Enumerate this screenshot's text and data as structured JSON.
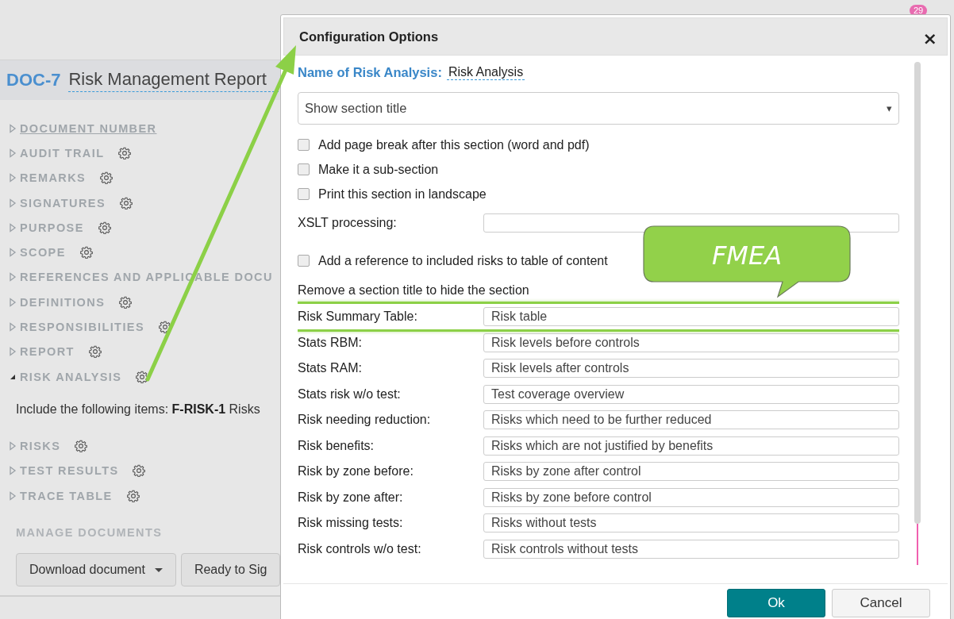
{
  "badge": "29",
  "document": {
    "id": "DOC-7",
    "title": "Risk Management Report"
  },
  "sections": [
    {
      "label": "DOCUMENT NUMBER",
      "expanded": false,
      "underlined": true,
      "settings": false
    },
    {
      "label": "AUDIT TRAIL",
      "expanded": false,
      "underlined": false,
      "settings": true
    },
    {
      "label": "REMARKS",
      "expanded": false,
      "underlined": false,
      "settings": true
    },
    {
      "label": "SIGNATURES",
      "expanded": false,
      "underlined": false,
      "settings": true
    },
    {
      "label": "PURPOSE",
      "expanded": false,
      "underlined": false,
      "settings": true
    },
    {
      "label": "SCOPE",
      "expanded": false,
      "underlined": false,
      "settings": true
    },
    {
      "label": "REFERENCES AND APPLICABLE DOCU",
      "expanded": false,
      "underlined": false,
      "settings": false
    },
    {
      "label": "DEFINITIONS",
      "expanded": false,
      "underlined": false,
      "settings": true
    },
    {
      "label": "RESPONSIBILITIES",
      "expanded": false,
      "underlined": false,
      "settings": true
    },
    {
      "label": "REPORT",
      "expanded": false,
      "underlined": false,
      "settings": true
    },
    {
      "label": "RISK ANALYSIS",
      "expanded": true,
      "underlined": false,
      "settings": true,
      "content": "Include the following items: **F-RISK-1** Risks"
    },
    {
      "label": "RISKS",
      "expanded": false,
      "underlined": false,
      "settings": true
    },
    {
      "label": "TEST RESULTS",
      "expanded": false,
      "underlined": false,
      "settings": true
    },
    {
      "label": "TRACE TABLE",
      "expanded": false,
      "underlined": false,
      "settings": true
    }
  ],
  "manage": {
    "title": "MANAGE DOCUMENTS",
    "buttons": [
      {
        "label": "Download document",
        "dropdown": true
      },
      {
        "label": "Ready to Sig",
        "dropdown": false
      }
    ]
  },
  "dialog": {
    "title": "Configuration Options",
    "close": "×",
    "options": [
      {
        "kind": "name",
        "label": "Name of Risk Analysis:",
        "value": "Risk Analysis"
      },
      {
        "kind": "select",
        "value": "Show section title",
        "caret": "▾"
      },
      {
        "kind": "checkbox",
        "label": "Add page break after this section (word and pdf)",
        "checked": false
      },
      {
        "kind": "checkbox",
        "label": "Make it a sub-section",
        "checked": false
      },
      {
        "kind": "checkbox",
        "label": "Print this section in landscape",
        "checked": false
      },
      {
        "kind": "field",
        "label": "XSLT processing:"
      },
      {
        "kind": "checkbox",
        "label": "Add a reference to included risks to table of content",
        "checked": false
      },
      {
        "kind": "note",
        "label": "Remove a section title to hide the section"
      }
    ],
    "titles": [
      {
        "label": "Risk Summary Table:",
        "value": "Risk table",
        "highlighted": true
      },
      {
        "label": "Stats RBM:",
        "value": "Risk levels before controls",
        "highlighted": false
      },
      {
        "label": "Stats RAM:",
        "value": "Risk levels after controls",
        "highlighted": false
      },
      {
        "label": "Stats risk w/o test:",
        "value": "Test coverage overview",
        "highlighted": false
      },
      {
        "label": "Risk needing reduction:",
        "value": "Risks which need to be further reduced",
        "highlighted": false
      },
      {
        "label": "Risk benefits:",
        "value": "Risks which are not justified by benefits",
        "highlighted": false
      },
      {
        "label": "Risk by zone before:",
        "value": "Risks by zone after control",
        "highlighted": false
      },
      {
        "label": "Risk by zone after:",
        "value": "Risks by zone before control",
        "highlighted": false
      },
      {
        "label": "Risk missing tests:",
        "value": "Risks without tests",
        "highlighted": false
      },
      {
        "label": "Risk controls w/o test:",
        "value": "Risk controls without tests",
        "highlighted": false
      }
    ],
    "buttons": [
      {
        "label": "Ok",
        "kind": "primary"
      },
      {
        "label": "Cancel",
        "kind": "default"
      }
    ]
  },
  "callout": {
    "text": "FMEA"
  }
}
